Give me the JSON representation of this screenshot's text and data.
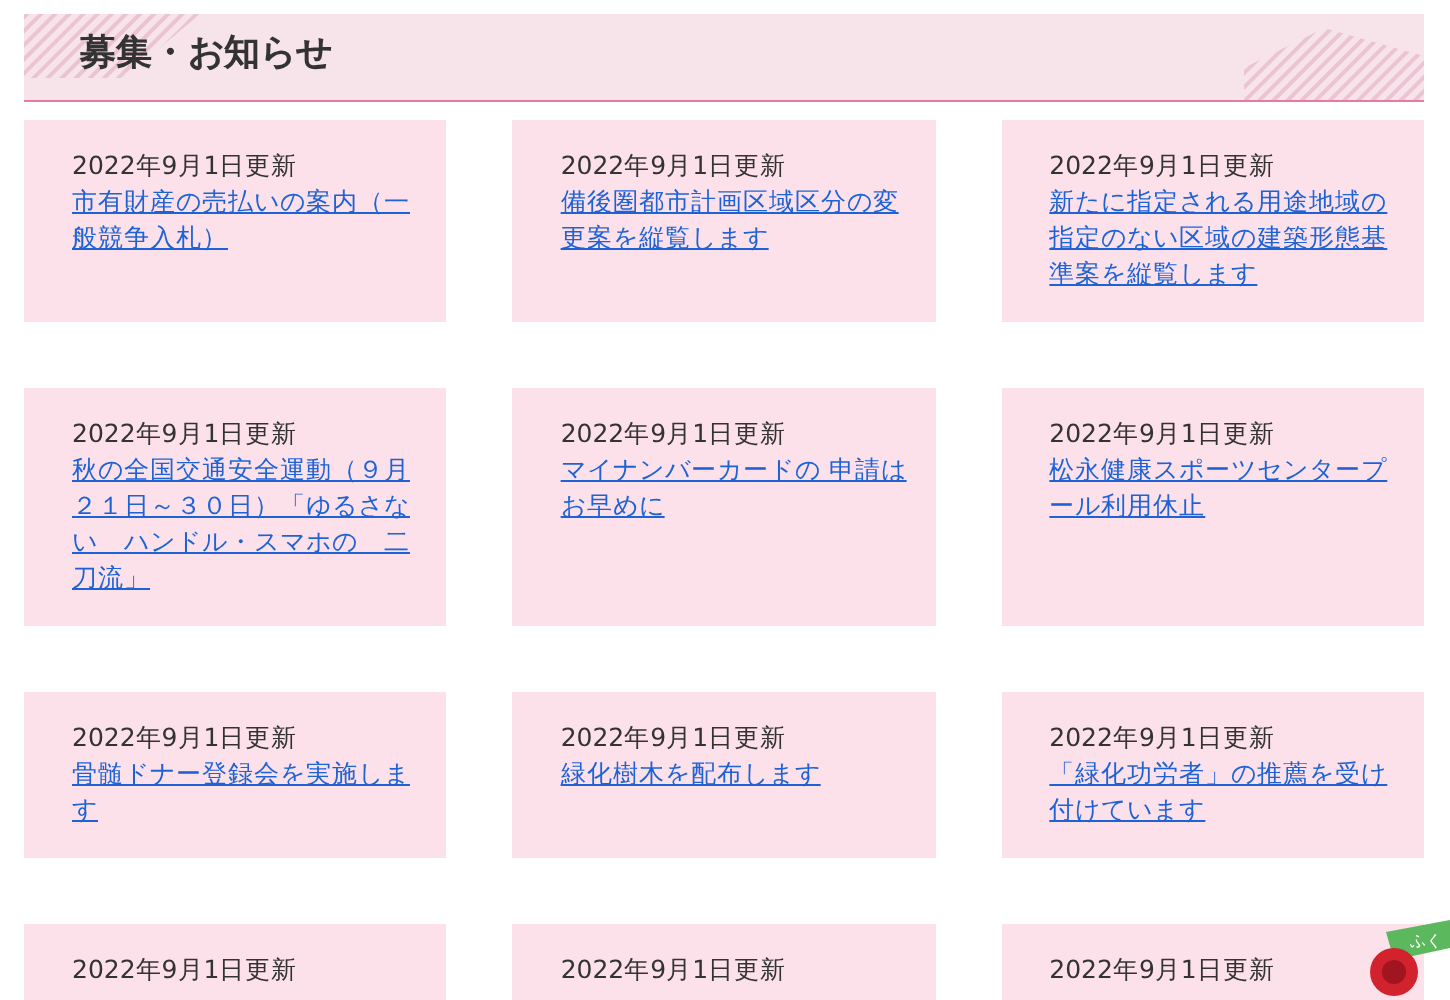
{
  "section": {
    "title": "募集・お知らせ"
  },
  "notices": [
    {
      "date": "2022年9月1日更新",
      "link": "市有財産の売払いの案内（一般競争入札）"
    },
    {
      "date": "2022年9月1日更新",
      "link": "備後圏都市計画区域区分の変更案を縦覧します"
    },
    {
      "date": "2022年9月1日更新",
      "link": "新たに指定される用途地域の指定のない区域の建築形態基準案を縦覧します"
    },
    {
      "date": "2022年9月1日更新",
      "link": "秋の全国交通安全運動（９月２１日～３０日）「ゆるさない　ハンドル・スマホの　二刀流」"
    },
    {
      "date": "2022年9月1日更新",
      "link": "マイナンバーカードの 申請はお早めに"
    },
    {
      "date": "2022年9月1日更新",
      "link": "松永健康スポーツセンタープール利用休止"
    },
    {
      "date": "2022年9月1日更新",
      "link": "骨髄ドナー登録会を実施します"
    },
    {
      "date": "2022年9月1日更新",
      "link": "緑化樹木を配布します"
    },
    {
      "date": "2022年9月1日更新",
      "link": "「緑化功労者」の推薦を受け付けています"
    },
    {
      "date": "2022年9月1日更新"
    },
    {
      "date": "2022年9月1日更新"
    },
    {
      "date": "2022年9月1日更新"
    }
  ],
  "mascot": {
    "banner": "ふく"
  }
}
